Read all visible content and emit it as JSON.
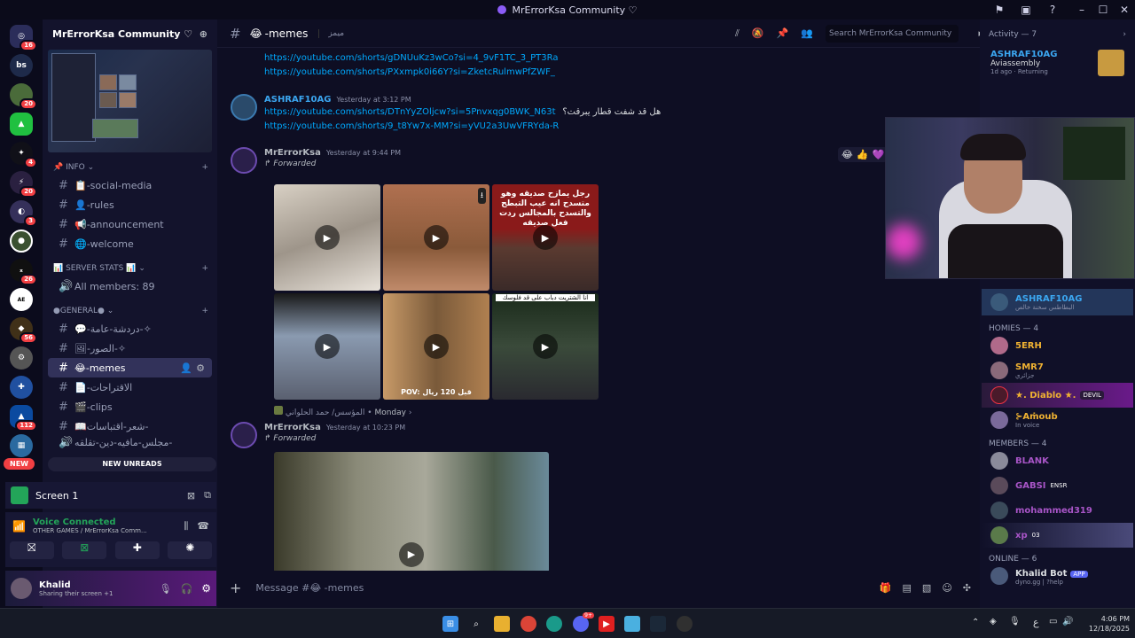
{
  "window": {
    "title": "MrErrorKsa Community ♡"
  },
  "guild_badges": [
    "16",
    "20",
    "4",
    "20",
    "3",
    "26",
    "56",
    "112"
  ],
  "sidebar": {
    "server_name": "MrErrorKsa Community ♡",
    "categories": {
      "info": "INFO",
      "server_stats": "SERVER STATS",
      "general": "●GENERAL●"
    },
    "info_channels": [
      "-social-media",
      "-rules",
      "-announcement",
      "-welcome"
    ],
    "server_stat": "All members: 89",
    "general_channels": [
      "-دردشة-عامة-✧",
      "-الصور-✧",
      "-memes",
      "-الاقتراحات",
      "-clips",
      "شعر-اقتباسات-",
      "مجلس-مافيه-دين-تقلقه-"
    ],
    "new_unreads": "NEW UNREADS",
    "new_pill": "NEW",
    "screen_label": "Screen 1",
    "voice_status": "Voice Connected",
    "voice_channel": "OTHER GAMES / MrErrorKsa Comm...",
    "user_name": "Khalid",
    "user_status": "Sharing their screen +1"
  },
  "header": {
    "channel": "-memes",
    "topic": "ميمز",
    "search_placeholder": "Search MrErrorKsa Community"
  },
  "messages": {
    "links_top": [
      "https://youtube.com/shorts/gDNUuKz3wCo?si=4_9vF1TC_3_PT3Ra",
      "https://youtube.com/shorts/PXxmpk0i66Y?si=ZketcRulmwPfZWF_"
    ],
    "m1": {
      "author": "ASHRAF10AG",
      "time": "Yesterday at 3:12 PM",
      "link1": "https://youtube.com/shorts/DTnYyZOljcw?si=5Pnvxqg0BWK_N63t",
      "link1_suffix": "هل قد شفت قطار يبرقت؟",
      "link2": "https://youtube.com/shorts/9_t8Yw7x-MM?si=yVU2a3UwVFRYda-R"
    },
    "m2": {
      "author": "MrErrorKsa",
      "time": "Yesterday at 9:44 PM",
      "forwarded": "Forwarded",
      "source": "المؤسس/ حمد الحلواني",
      "source_day": "Monday",
      "thumb3_text": "رجل يمازح صديقه وهو متسدح انه عيب التبطح والتسدح بالمجالس ردت فعل صديقه",
      "thumb4_text": "انا الشتريت دباب على قد فلوسك",
      "thumb5_text": "POV: قبل 120 ريال"
    },
    "m3": {
      "author": "MrErrorKsa",
      "time": "Yesterday at 10:23 PM",
      "forwarded": "Forwarded"
    }
  },
  "composer": {
    "placeholder": "Message #😂 -memes"
  },
  "members": {
    "activity": "Activity — 7",
    "activity_user": "ASHRAF10AG",
    "activity_game": "Aviassembly",
    "activity_meta": "1d ago · Returning",
    "voice_user": "ASHRAF10AG",
    "voice_sub": "البطاطس سخنة خالص",
    "homies": "HOMIES — 4",
    "homies_list": [
      {
        "name": "5ERH",
        "color": "#f0b232",
        "sub": ""
      },
      {
        "name": "SMR7",
        "color": "#f0b232",
        "sub": "جزائري"
      },
      {
        "name": "★. Diablo ★.",
        "color": "#f0b232",
        "sub": "",
        "tag": "DEVIL"
      },
      {
        "name": "⊱Aṁoub",
        "color": "#f0b232",
        "sub": "In voice"
      }
    ],
    "members_group": "MEMBERS — 4",
    "members_list": [
      {
        "name": "BLANK",
        "color": "#a855c7"
      },
      {
        "name": "GABSI",
        "color": "#a855c7",
        "tag": "ENSR"
      },
      {
        "name": "mohammed319",
        "color": "#a855c7"
      },
      {
        "name": "xp",
        "color": "#a855c7",
        "tag": "03"
      }
    ],
    "online": "Online — 6",
    "bot_name": "Khalid Bot",
    "bot_tag": "APP",
    "bot_sub": "dyno.gg | ?help"
  },
  "taskbar": {
    "time": "4:06 PM",
    "date": "12/18/2025",
    "lang": "ع",
    "discord_badge": "9+"
  }
}
